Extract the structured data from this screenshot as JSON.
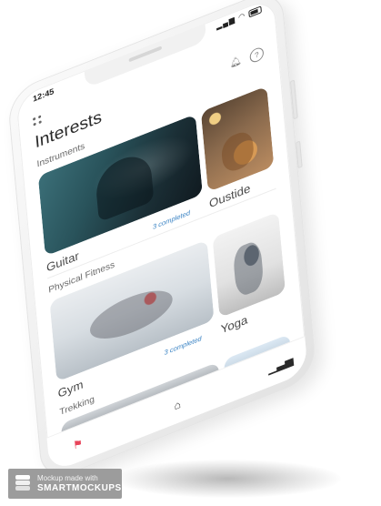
{
  "status": {
    "time": "12:45"
  },
  "header": {
    "title": "Interests",
    "bell_icon": "bell-icon",
    "help_icon": "help-icon"
  },
  "sections": [
    {
      "label": "Instruments",
      "items": [
        {
          "name": "Guitar",
          "completed": "3 completed",
          "image": "guitar-photo"
        },
        {
          "name": "Oustide",
          "image": "outside-photo"
        }
      ]
    },
    {
      "label": "Physical Fitness",
      "items": [
        {
          "name": "Gym",
          "completed": "3 completed",
          "image": "gym-photo"
        },
        {
          "name": "Yoga",
          "image": "yoga-photo"
        }
      ]
    },
    {
      "label": "Trekking",
      "items": [
        {
          "image": "trekking-photo"
        },
        {
          "image": "trekking-photo"
        }
      ]
    }
  ],
  "tabbar": {
    "items": [
      {
        "icon": "flag-icon",
        "active": true,
        "color": "#e8445a"
      },
      {
        "icon": "home-icon"
      },
      {
        "icon": "bar-chart-icon"
      }
    ]
  },
  "watermark": {
    "line1": "Mockup made with",
    "line2": "SMARTMOCKUPS"
  },
  "colors": {
    "accent": "#e8445a",
    "link": "#3a83c4"
  }
}
